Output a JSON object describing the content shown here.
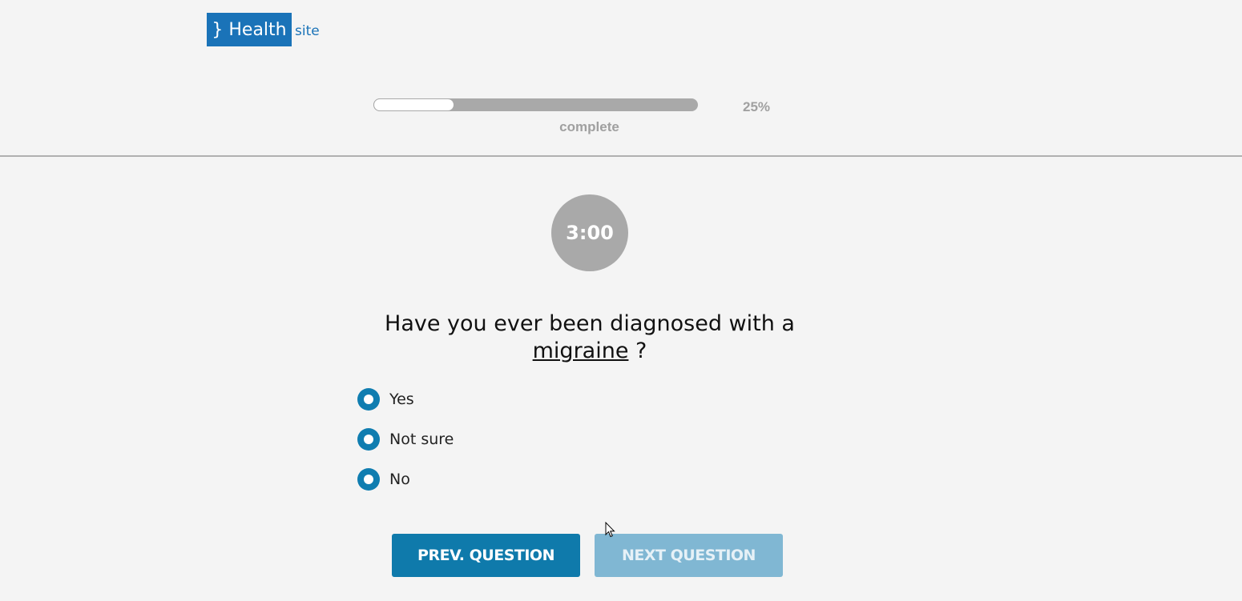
{
  "logo": {
    "brand": "} Health",
    "suffix": "site"
  },
  "progress": {
    "value_fraction": 0.25,
    "percent_label": "25%",
    "caption": "complete"
  },
  "timer": {
    "display": "3:00"
  },
  "question": {
    "text_before": "Have you ever been diagnosed with a",
    "term": "migraine",
    "text_after": "?"
  },
  "options": [
    {
      "label": "Yes"
    },
    {
      "label": "Not sure"
    },
    {
      "label": "No"
    }
  ],
  "buttons": {
    "prev_label": "PREV. QUESTION",
    "next_label": "NEXT QUESTION"
  },
  "colors": {
    "brand": "#1a73b8",
    "accent": "#0f7aab",
    "accent_disabled": "#80b7d3",
    "muted": "#a9a9a9",
    "background": "#f4f4f4"
  },
  "icons": {
    "cursor": "mouse-pointer-icon"
  }
}
